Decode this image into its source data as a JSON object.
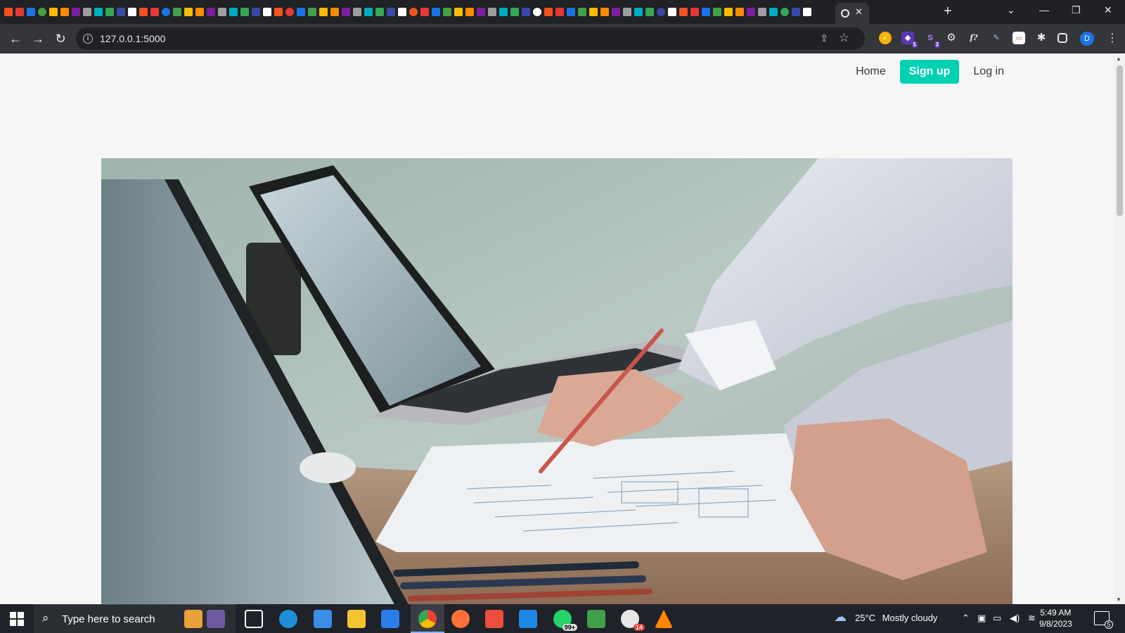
{
  "browser": {
    "address_bar": {
      "url": "127.0.0.1:5000"
    },
    "profile_initial": "D",
    "extensions": [
      {
        "name": "extension-badge-icon",
        "badge": "5"
      },
      {
        "name": "extension-s-icon",
        "label": "S",
        "badge": "3"
      },
      {
        "name": "extension-function-icon",
        "label": "f?"
      }
    ]
  },
  "page": {
    "nav": {
      "home": "Home",
      "signup": "Sign up",
      "login": "Log in"
    }
  },
  "taskbar": {
    "search_placeholder": "Type here to search",
    "whatsapp_badge": "99+",
    "app_badge": "14",
    "weather": {
      "temp": "25°C",
      "condition": "Mostly cloudy"
    },
    "clock": {
      "time": "5:49 AM",
      "date": "9/8/2023"
    },
    "notification_count": "5"
  }
}
